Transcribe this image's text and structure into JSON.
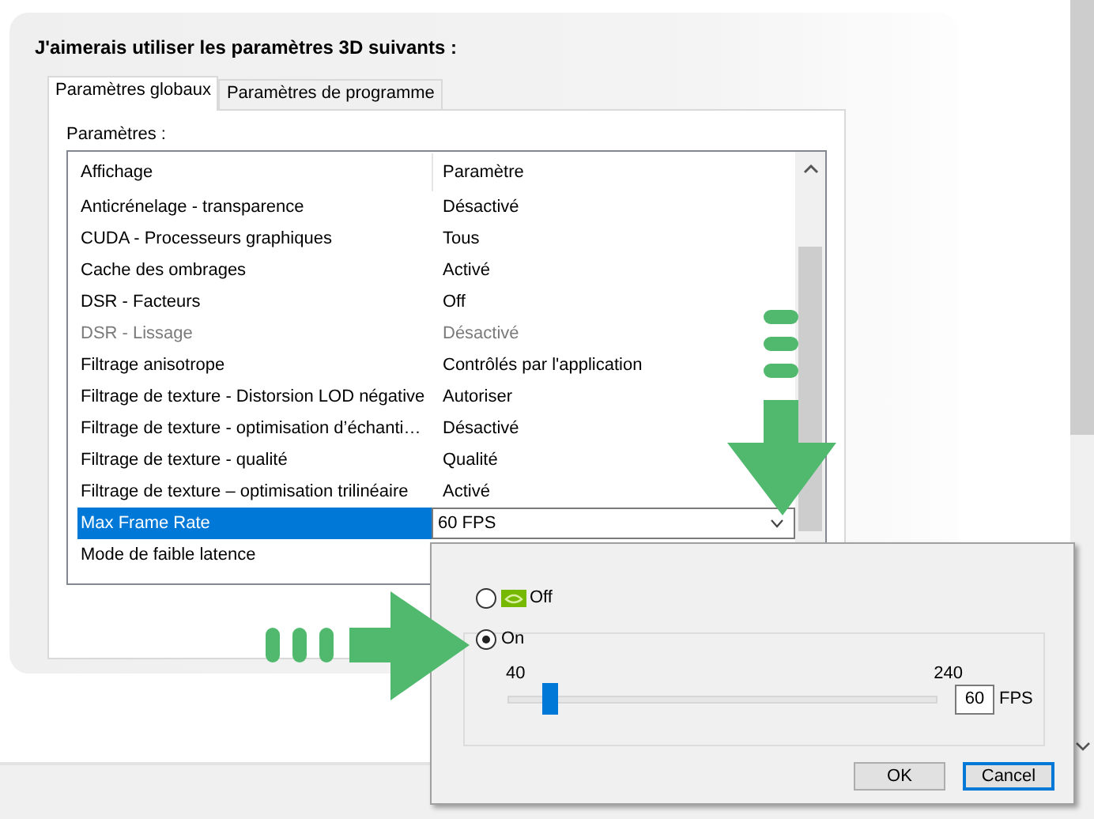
{
  "heading": "J'aimerais utiliser les paramètres 3D suivants :",
  "tabs": [
    {
      "label": "Paramètres globaux",
      "selected": true
    },
    {
      "label": "Paramètres de programme",
      "selected": false
    }
  ],
  "settings": {
    "label": "Paramètres :",
    "columns": [
      "Affichage",
      "Paramètre"
    ],
    "rows": [
      {
        "feature": "Anticrénelage - transparence",
        "value": "Désactivé",
        "disabled": false,
        "selected": false
      },
      {
        "feature": "CUDA - Processeurs graphiques",
        "value": "Tous",
        "disabled": false,
        "selected": false
      },
      {
        "feature": "Cache des ombrages",
        "value": "Activé",
        "disabled": false,
        "selected": false
      },
      {
        "feature": "DSR - Facteurs",
        "value": "Off",
        "disabled": false,
        "selected": false
      },
      {
        "feature": "DSR - Lissage",
        "value": "Désactivé",
        "disabled": true,
        "selected": false
      },
      {
        "feature": "Filtrage anisotrope",
        "value": "Contrôlés par l'application",
        "disabled": false,
        "selected": false
      },
      {
        "feature": "Filtrage de texture - Distorsion LOD négative",
        "value": "Autoriser",
        "disabled": false,
        "selected": false
      },
      {
        "feature": "Filtrage de texture - optimisation d’échanti…",
        "value": "Désactivé",
        "disabled": false,
        "selected": false
      },
      {
        "feature": "Filtrage de texture - qualité",
        "value": "Qualité",
        "disabled": false,
        "selected": false
      },
      {
        "feature": "Filtrage de texture – optimisation trilinéaire",
        "value": "Activé",
        "disabled": false,
        "selected": false
      },
      {
        "feature": "Max Frame Rate",
        "value": "60 FPS",
        "disabled": false,
        "selected": true
      },
      {
        "feature": "Mode de faible latence",
        "disabled": false,
        "selected": false
      }
    ]
  },
  "popup": {
    "options": [
      {
        "label": "Off",
        "selected": false,
        "kind": "badge"
      },
      {
        "label": "On",
        "selected": true,
        "kind": "slider"
      }
    ],
    "slider": {
      "min_label": "40",
      "max_label": "240",
      "level": 0.1
    },
    "value": "60",
    "unit": "FPS",
    "buttons": [
      {
        "label": "OK",
        "focused": false
      },
      {
        "label": "Cancel",
        "focused": true
      }
    ]
  },
  "annotations": [
    {
      "kind": "down-arrow"
    },
    {
      "kind": "right-arrow"
    }
  ]
}
